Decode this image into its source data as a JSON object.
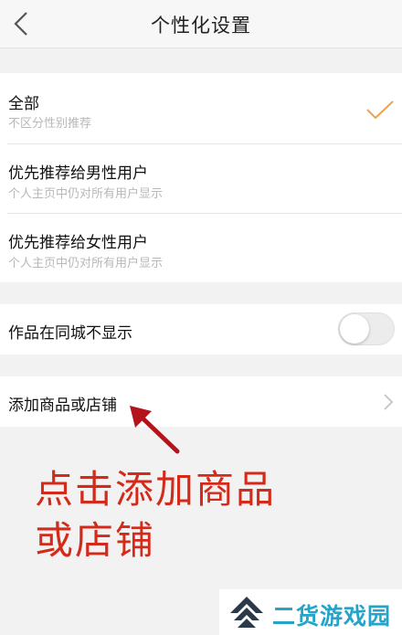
{
  "header": {
    "title": "个性化设置",
    "back_icon": "back-arrow-icon"
  },
  "recommend_group": {
    "items": [
      {
        "label": "全部",
        "sub": "不区分性别推荐",
        "selected": true
      },
      {
        "label": "优先推荐给男性用户",
        "sub": "个人主页中仍对所有用户显示",
        "selected": false
      },
      {
        "label": "优先推荐给女性用户",
        "sub": "个人主页中仍对所有用户显示",
        "selected": false
      }
    ]
  },
  "city_group": {
    "label": "作品在同城不显示",
    "toggle_on": false
  },
  "goods_group": {
    "label": "添加商品或店铺"
  },
  "annotation": {
    "text_line1": "点击添加商品",
    "text_line2": "或店铺"
  },
  "watermark": {
    "text": "二货游戏园"
  },
  "colors": {
    "accent_check": "#f0a24a",
    "annotation_red": "#d42a1a",
    "watermark_blue": "#24a4c9"
  }
}
